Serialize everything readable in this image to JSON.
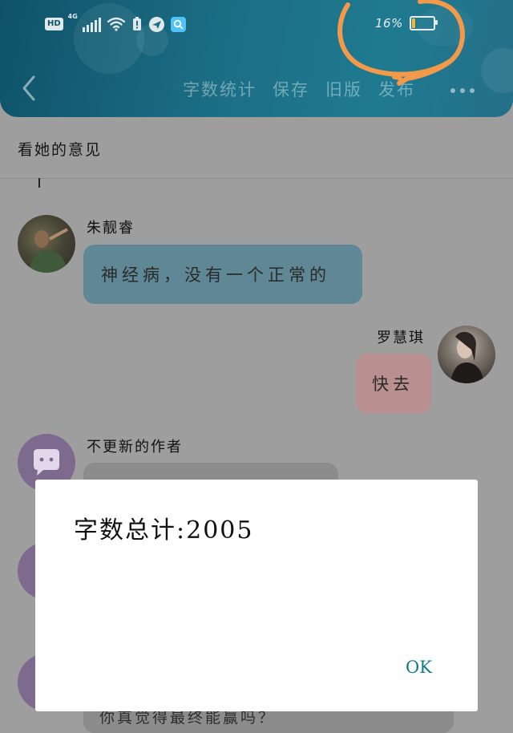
{
  "status_bar": {
    "hd_badge": "HD",
    "network": "4G",
    "battery_percent_text": "16%",
    "battery_level": 0.16,
    "battery_color": "#f4b73c",
    "icons": [
      "hd-icon",
      "signal-icon",
      "wifi-icon",
      "battery-alert-icon",
      "bird-app-icon",
      "search-app-icon",
      "battery-icon"
    ]
  },
  "nav": {
    "back_icon": "back-arrow-icon",
    "items": [
      "字数统计",
      "保存",
      "旧版",
      "发布"
    ],
    "more_icon": "more-dots-icon"
  },
  "document": {
    "title": "看她的意见"
  },
  "messages": [
    {
      "sender": "朱靓睿",
      "text": "神经病，没有一个正常的",
      "side": "left",
      "bubble_color": "#5f8796"
    },
    {
      "sender": "罗慧琪",
      "text": "快去",
      "side": "right",
      "bubble_color": "#b98f90"
    },
    {
      "sender": "不更新的作者",
      "text": "",
      "side": "left",
      "bubble_color": "#8c8c8c"
    },
    {
      "sender": "",
      "text": "你真觉得最终能赢吗？",
      "side": "left",
      "bubble_color": "#8c8c8c"
    }
  ],
  "dialog": {
    "text": "字数总计:2005",
    "ok_label": "OK"
  },
  "colors": {
    "header_gradient_start": "#0f5269",
    "header_gradient_end": "#256f88",
    "annotation_orange": "#f29a4a",
    "ok_accent": "#0c7b8e",
    "overlay_dim": "#9e9e9e"
  }
}
